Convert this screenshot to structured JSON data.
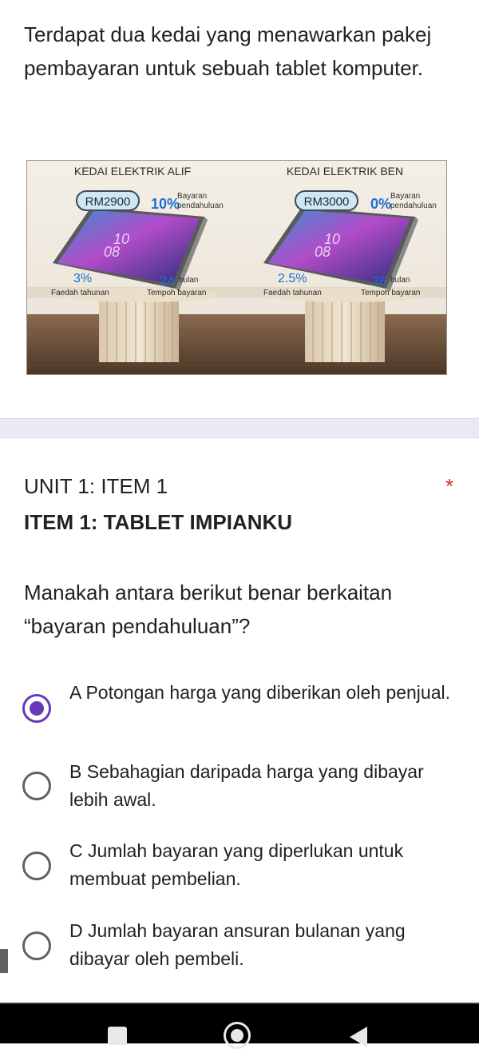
{
  "intro_text": "Terdapat dua kedai yang menawarkan pakej pembayaran untuk sebuah tablet komputer.",
  "promo": {
    "left": {
      "shop": "KEDAI ELEKTRIK ALIF",
      "price": "RM2900",
      "deposit": "10%",
      "deposit_label_1": "Bayaran",
      "deposit_label_2": "pendahuluan",
      "screen_num_1": "10",
      "screen_num_2": "08",
      "interest": "3%",
      "interest_label": "Faedah tahunan",
      "term": "24",
      "term_unit": "bulan",
      "term_label": "Tempoh bayaran"
    },
    "right": {
      "shop": "KEDAI ELEKTRIK BEN",
      "price": "RM3000",
      "deposit": "0%",
      "deposit_label_1": "Bayaran",
      "deposit_label_2": "pendahuluan",
      "screen_num_1": "10",
      "screen_num_2": "08",
      "interest": "2.5%",
      "interest_label": "Faedah tahunan",
      "term": "36",
      "term_unit": "bulan",
      "term_label": "Tempoh bayaran"
    }
  },
  "unit_title": "UNIT 1: ITEM 1",
  "required_mark": "*",
  "item_title": "ITEM 1: TABLET IMPIANKU",
  "question": "Manakah antara berikut benar berkaitan “bayaran pendahuluan”?",
  "options": [
    {
      "label": "A Potongan harga yang diberikan oleh penjual.",
      "selected": true
    },
    {
      "label": "B Sebahagian daripada harga yang dibayar lebih awal.",
      "selected": false
    },
    {
      "label": "C Jumlah bayaran yang diperlukan untuk membuat pembelian.",
      "selected": false
    },
    {
      "label": "D Jumlah bayaran ansuran bulanan yang dibayar oleh pembeli.",
      "selected": false
    }
  ],
  "colors": {
    "accent": "#673ab7",
    "required": "#d93025",
    "band": "#ece9f7",
    "price_badge": "#cfe6f4"
  },
  "nav": {
    "recents_icon": "square-icon",
    "home_icon": "circle-icon",
    "back_icon": "triangle-back-icon"
  }
}
